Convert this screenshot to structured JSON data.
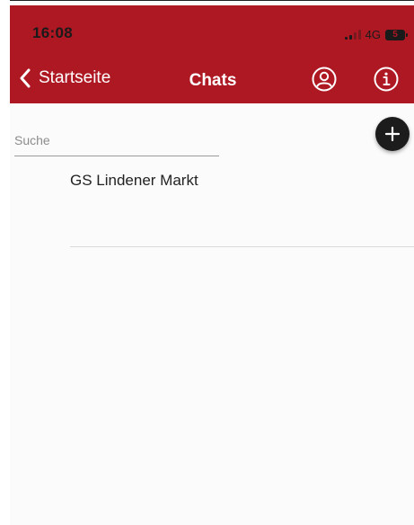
{
  "status_bar": {
    "time": "16:08",
    "network": "4G",
    "battery": "5"
  },
  "nav": {
    "back_label": "Startseite",
    "title": "Chats"
  },
  "search": {
    "placeholder": "Suche",
    "value": ""
  },
  "chats": [
    {
      "name": "GS Lindener Markt"
    }
  ],
  "icons": {
    "back": "chevron-left-icon",
    "profile": "user-circle-icon",
    "info": "info-circle-icon",
    "add": "plus-icon"
  },
  "colors": {
    "header": "#ae1823",
    "fab": "#1c1c1c",
    "background": "#fbfbfb"
  }
}
